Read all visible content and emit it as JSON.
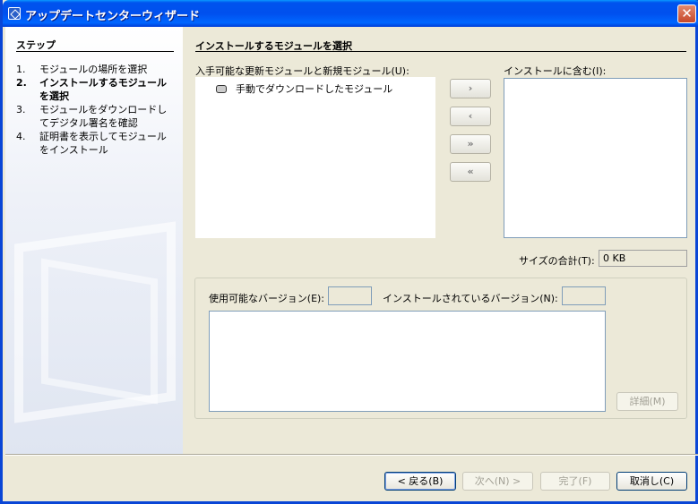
{
  "window": {
    "title": "アップデートセンターウィザード",
    "close_label": "✕"
  },
  "steps": {
    "title": "ステップ",
    "items": [
      {
        "num": "1.",
        "label": "モジュールの場所を選択"
      },
      {
        "num": "2.",
        "label": "インストールするモジュールを選択"
      },
      {
        "num": "3.",
        "label": "モジュールをダウンロードしてデジタル署名を確認"
      },
      {
        "num": "4.",
        "label": "証明書を表示してモジュールをインストール"
      }
    ]
  },
  "content": {
    "title": "インストールするモジュールを選択",
    "available_label": "入手可能な更新モジュールと新規モジュール(U):",
    "available_items": [
      "手動でダウンロードしたモジュール"
    ],
    "include_label": "インストールに含む(I):",
    "arrows": {
      "add": "›",
      "remove": "‹",
      "add_all": "»",
      "remove_all": "«"
    },
    "size_label": "サイズの合計(T):",
    "size_value": "0 KB",
    "available_version_label": "使用可能なバージョン(E):",
    "installed_version_label": "インストールされているバージョン(N):",
    "details_label": "詳細(M)"
  },
  "buttons": {
    "back": "< 戻る(B)",
    "next": "次へ(N) >",
    "finish": "完了(F)",
    "cancel": "取消し(C)"
  }
}
